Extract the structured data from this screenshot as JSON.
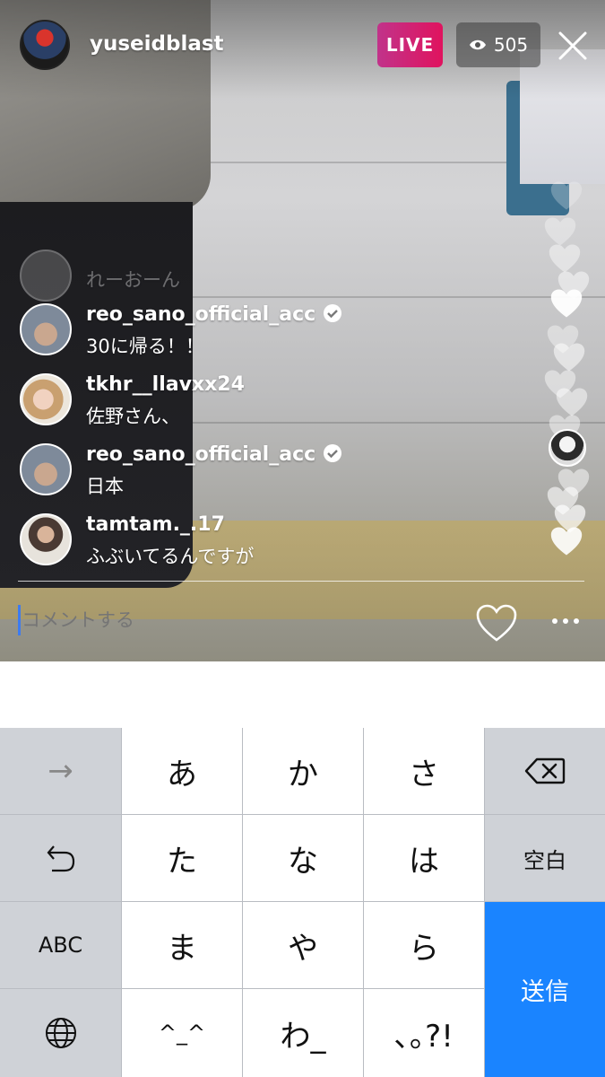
{
  "header": {
    "host_name": "yuseidblast",
    "live_label": "LIVE",
    "viewer_count": "505"
  },
  "comments": [
    {
      "user": "",
      "text": "れーおーん",
      "verified": false,
      "faded": true
    },
    {
      "user": "reo_sano_official_acc",
      "text": "30に帰る！！",
      "verified": true
    },
    {
      "user": "tkhr__llavxx24",
      "text": "佐野さん、",
      "verified": false
    },
    {
      "user": "reo_sano_official_acc",
      "text": "日本",
      "verified": true
    },
    {
      "user": "tamtam._.17",
      "text": "ふぶいてるんですが",
      "verified": false
    }
  ],
  "input": {
    "placeholder": "コメントする"
  },
  "keyboard": {
    "row1": [
      "→",
      "あ",
      "か",
      "さ",
      "⌫"
    ],
    "row2": [
      "↺",
      "た",
      "な",
      "は",
      "空白"
    ],
    "row3": [
      "ABC",
      "ま",
      "や",
      "ら"
    ],
    "row4": [
      "🌐",
      "^_^",
      "わ_",
      "､｡?!"
    ],
    "send_label": "送信"
  },
  "colors": {
    "live_badge": "#e0135e",
    "send_key": "#1a84ff",
    "cursor": "#3d7bf0"
  }
}
